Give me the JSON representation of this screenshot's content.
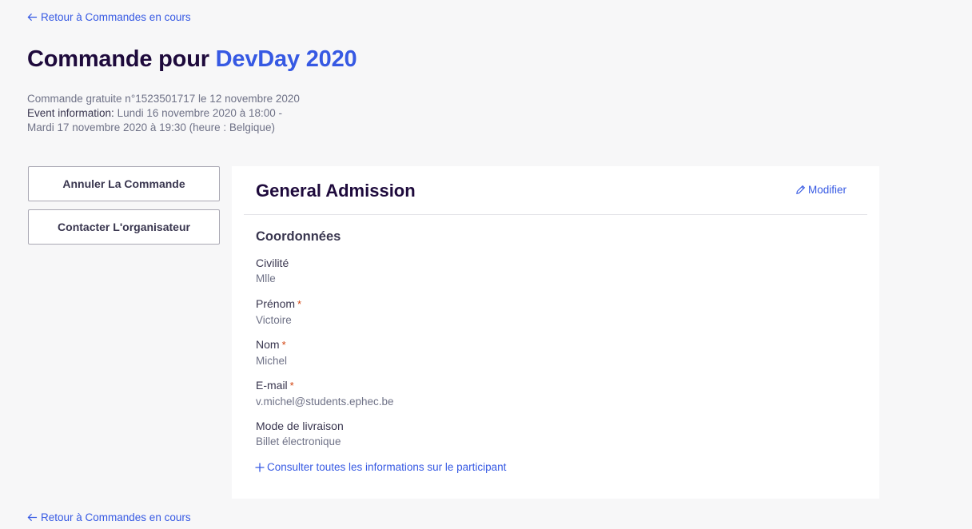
{
  "nav": {
    "back_label": "Retour à Commandes en cours"
  },
  "header": {
    "title_prefix": "Commande pour",
    "event_name": "DevDay 2020",
    "order_line": "Commande gratuite n°1523501717 le 12 novembre 2020",
    "event_info_label": "Event information:",
    "event_info_dates": "Lundi 16 novembre 2020 à 18:00 -",
    "event_info_dates_2": "Mardi 17 novembre 2020 à 19:30 (heure : Belgique)"
  },
  "actions": {
    "cancel_label": "Annuler La Commande",
    "contact_label": "Contacter L'organisateur"
  },
  "ticket": {
    "title": "General Admission",
    "edit_label": "Modifier",
    "section_title": "Coordonnées",
    "fields": [
      {
        "label": "Civilité",
        "value": "Mlle",
        "required": false
      },
      {
        "label": "Prénom",
        "value": "Victoire",
        "required": true
      },
      {
        "label": "Nom",
        "value": "Michel",
        "required": true
      },
      {
        "label": "E-mail",
        "value": "v.michel@students.ephec.be",
        "required": true
      },
      {
        "label": "Mode de livraison",
        "value": "Billet électronique",
        "required": false
      }
    ],
    "required_marker": "*",
    "more_label": "Consulter toutes les informations sur le participant"
  },
  "colors": {
    "accent": "#3659e3",
    "title": "#1e0a3c",
    "required": "#d1410c"
  },
  "icons": {
    "back": "arrow-left-icon",
    "edit": "pencil-icon",
    "more": "plus-icon"
  }
}
